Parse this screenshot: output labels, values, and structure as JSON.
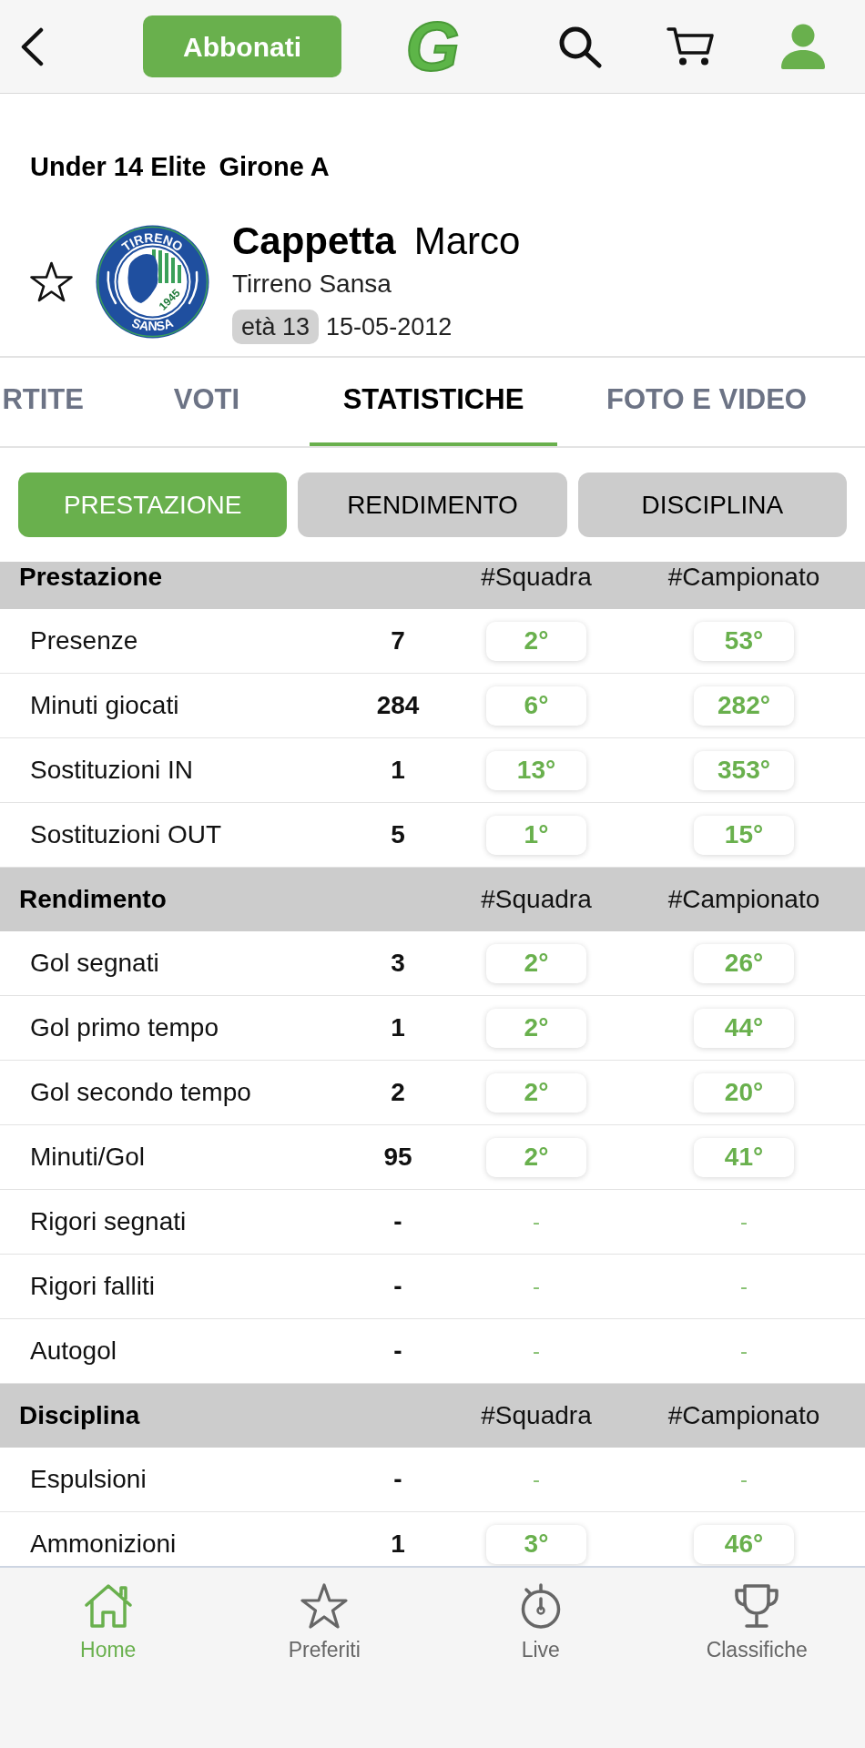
{
  "top_bar": {
    "subscribe_button": "Abbonati",
    "logo": "G"
  },
  "competition": {
    "category": "Under 14 Elite",
    "group": "Girone A"
  },
  "player": {
    "favorite": false,
    "surname": "Cappetta",
    "name": "Marco",
    "team": "Tirreno Sansa",
    "age": "età 13",
    "birth_date": "15-05-2012",
    "crest": {
      "top": "TIRRENO",
      "bottom": "SANSA",
      "year": "1945"
    }
  },
  "tabs": [
    {
      "label": "RTITE",
      "selected": false
    },
    {
      "label": "VOTI",
      "selected": false
    },
    {
      "label": "STATISTICHE",
      "selected": true
    },
    {
      "label": "FOTO E VIDEO",
      "selected": false
    }
  ],
  "segments": [
    {
      "label": "PRESTAZIONE",
      "selected": true
    },
    {
      "label": "RENDIMENTO",
      "selected": false
    },
    {
      "label": "DISCIPLINA",
      "selected": false
    }
  ],
  "sections": [
    {
      "title": "Prestazione",
      "columns": [
        "#Squadra",
        "#Campionato"
      ],
      "rows": [
        {
          "kind": "ranked",
          "label": "Presenze",
          "value": "7",
          "team_rank": "2°",
          "league_rank": "53°"
        },
        {
          "kind": "ranked",
          "label": "Minuti giocati",
          "value": "284",
          "team_rank": "6°",
          "league_rank": "282°"
        },
        {
          "kind": "ranked",
          "label": "Sostituzioni IN",
          "value": "1",
          "team_rank": "13°",
          "league_rank": "353°"
        },
        {
          "kind": "ranked",
          "label": "Sostituzioni OUT",
          "value": "5",
          "team_rank": "1°",
          "league_rank": "15°"
        }
      ]
    },
    {
      "title": "Rendimento",
      "columns": [
        "#Squadra",
        "#Campionato"
      ],
      "rows": [
        {
          "kind": "ranked",
          "label": "Gol segnati",
          "value": "3",
          "team_rank": "2°",
          "league_rank": "26°"
        },
        {
          "kind": "ranked",
          "label": "Gol primo tempo",
          "value": "1",
          "team_rank": "2°",
          "league_rank": "44°"
        },
        {
          "kind": "ranked",
          "label": "Gol secondo tempo",
          "value": "2",
          "team_rank": "2°",
          "league_rank": "20°"
        },
        {
          "kind": "ranked",
          "label": "Minuti/Gol",
          "value": "95",
          "team_rank": "2°",
          "league_rank": "41°"
        },
        {
          "kind": "unranked",
          "label": "Rigori segnati",
          "value": "-",
          "team_rank": "-",
          "league_rank": "-"
        },
        {
          "kind": "unranked",
          "label": "Rigori falliti",
          "value": "-",
          "team_rank": "-",
          "league_rank": "-"
        },
        {
          "kind": "unranked",
          "label": "Autogol",
          "value": "-",
          "team_rank": "-",
          "league_rank": "-"
        }
      ]
    },
    {
      "title": "Disciplina",
      "columns": [
        "#Squadra",
        "#Campionato"
      ],
      "rows": [
        {
          "kind": "unranked",
          "label": "Espulsioni",
          "value": "-",
          "team_rank": "-",
          "league_rank": "-"
        },
        {
          "kind": "ranked",
          "label": "Ammonizioni",
          "value": "1",
          "team_rank": "3°",
          "league_rank": "46°"
        }
      ]
    }
  ],
  "bottom_nav": [
    {
      "label": "Home",
      "selected": true
    },
    {
      "label": "Preferiti",
      "selected": false
    },
    {
      "label": "Live",
      "selected": false
    },
    {
      "label": "Classifiche",
      "selected": false
    }
  ]
}
